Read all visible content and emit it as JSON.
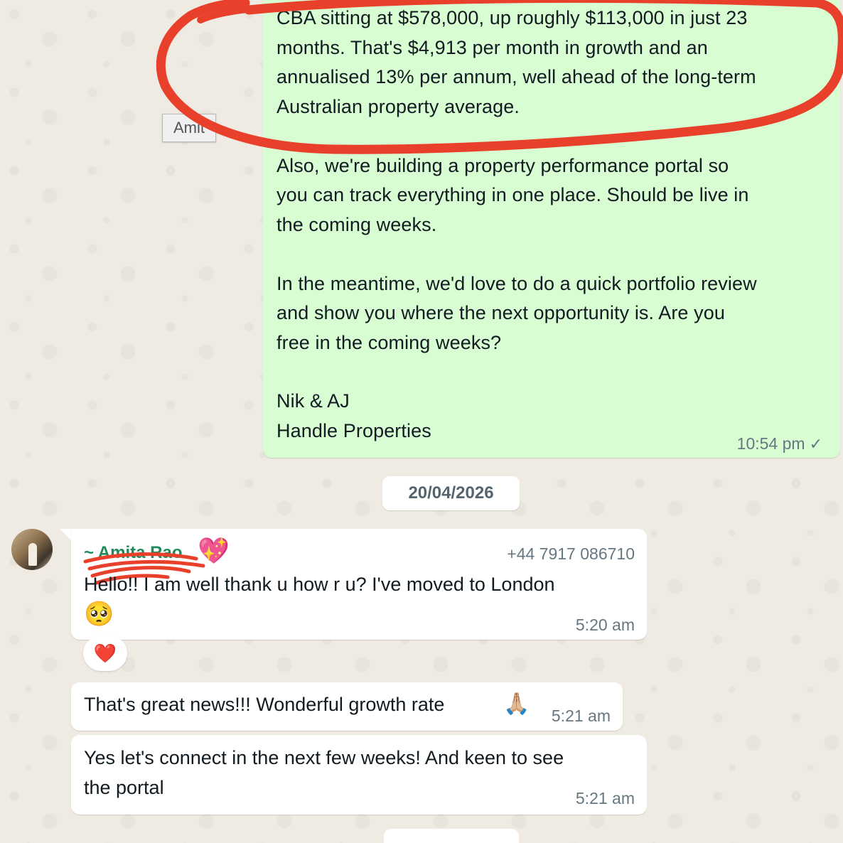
{
  "outgoing": {
    "lines": [
      "CBA sitting at $578,000, up roughly $113,000 in just 23",
      "months. That's $4,913 per month in growth and an",
      "annualised 13% per annum, well ahead of the long-term",
      "Australian property average.",
      "Also, we're building a property performance portal so",
      "you can track everything in one place. Should be live in",
      "the coming weeks.",
      "In the meantime, we'd love to do a quick portfolio review",
      "and show you where the next opportunity is. Are you",
      "free in the coming weeks?",
      "Nik & AJ",
      "Handle Properties"
    ],
    "time": "10:54 pm",
    "status_icon": "single-check-icon",
    "tick_glyph": "✓"
  },
  "tooltip": {
    "text": "Amit"
  },
  "date_separator": "20/04/2026",
  "incoming": {
    "sender_name": "~ Amita Rao",
    "sender_emoji": "💖",
    "phone": "+44 7917 086710",
    "message1_line1": "Hello!! I am well thank u how r u? I've moved to London",
    "message1_emoji": "🥺",
    "message1_time": "5:20 am",
    "reaction": "❤️",
    "message2_text": "That's great news!!! Wonderful growth rate",
    "message2_emoji": "🙏🏼",
    "message2_time": "5:21 am",
    "message3_line1": "Yes let's connect in the next few weeks! And keen to see",
    "message3_line2": "the portal",
    "message3_time": "5:21 am"
  },
  "colors": {
    "outgoing_bubble": "#d9fdd3",
    "incoming_bubble": "#ffffff",
    "background": "#efeae2",
    "annotation_red": "#e8402a",
    "sender_green": "#1f8a5a"
  }
}
